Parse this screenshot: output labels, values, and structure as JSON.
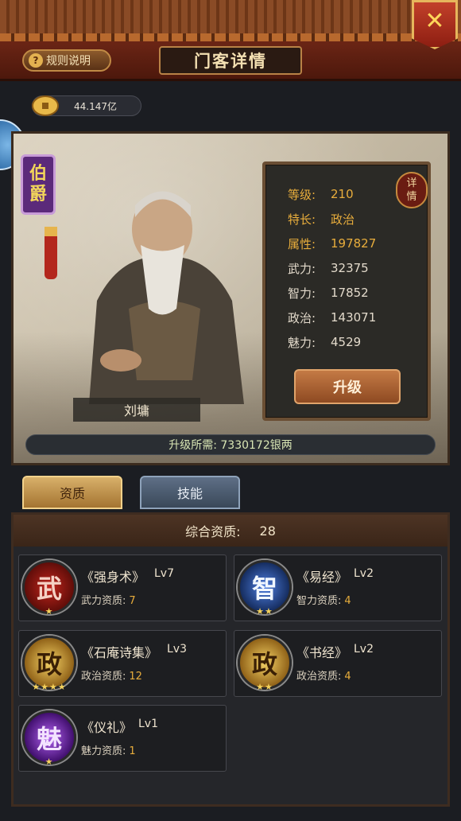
{
  "header": {
    "rules_label": "规则说明",
    "rules_icon": "?",
    "title": "门客详情",
    "close_label": "✕"
  },
  "currency": {
    "amount": "44.147亿"
  },
  "retainer": {
    "rank": [
      "伯",
      "爵"
    ],
    "name": "刘墉",
    "detail_label": [
      "详",
      "情"
    ],
    "stats": [
      {
        "label": "等级:",
        "value": "210",
        "style": "gold"
      },
      {
        "label": "特长:",
        "value": "政治",
        "style": "gold"
      },
      {
        "label": "属性:",
        "value": "197827",
        "style": "gold"
      },
      {
        "label": "武力:",
        "value": "32375",
        "style": "plain"
      },
      {
        "label": "智力:",
        "value": "17852",
        "style": "plain"
      },
      {
        "label": "政治:",
        "value": "143071",
        "style": "plain"
      },
      {
        "label": "魅力:",
        "value": "4529",
        "style": "plain"
      }
    ],
    "upgrade_label": "升级",
    "cost_text": "升级所需: 7330172银两"
  },
  "tabs": [
    {
      "label": "资质",
      "active": true
    },
    {
      "label": "技能",
      "active": false
    }
  ],
  "aptitude": {
    "header_label": "综合资质:",
    "total": "28",
    "skills": [
      {
        "glyph": "武",
        "color": "red",
        "stars": "★",
        "name": "《强身术》",
        "lv": "Lv7",
        "apt_label": "武力资质:",
        "apt_value": "7"
      },
      {
        "glyph": "智",
        "color": "blue",
        "stars": "★★",
        "name": "《易经》",
        "lv": "Lv2",
        "apt_label": "智力资质:",
        "apt_value": "4"
      },
      {
        "glyph": "政",
        "color": "gold",
        "stars": "★★★★",
        "name": "《石庵诗集》",
        "lv": "Lv3",
        "apt_label": "政治资质:",
        "apt_value": "12"
      },
      {
        "glyph": "政",
        "color": "gold",
        "stars": "★★",
        "name": "《书经》",
        "lv": "Lv2",
        "apt_label": "政治资质:",
        "apt_value": "4"
      },
      {
        "glyph": "魅",
        "color": "purple",
        "stars": "★",
        "name": "《仪礼》",
        "lv": "Lv1",
        "apt_label": "魅力资质:",
        "apt_value": "1"
      }
    ]
  },
  "colors": {
    "accent_gold": "#e8ad3c",
    "header_red": "#6b2515",
    "panel_dark": "#25262a"
  }
}
